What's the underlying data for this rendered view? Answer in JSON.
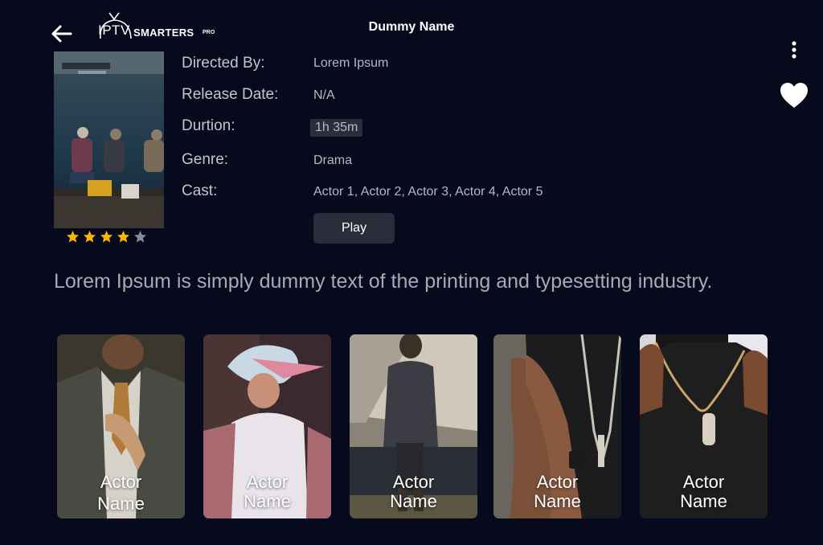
{
  "header": {
    "title": "Dummy Name",
    "logo": {
      "iptv": "IPTV",
      "smarters": "SMARTERS",
      "pro": "PRO"
    },
    "icons": {
      "back": "arrow-left-icon",
      "menu": "more-vertical-icon",
      "favorite": "heart-icon"
    }
  },
  "details": {
    "directed_by_label": "Directed By:",
    "directed_by": "Lorem  Ipsum",
    "release_date_label": "Release Date:",
    "release_date": "N/A",
    "duration_label": "Durtion:",
    "duration": "1h 35m",
    "genre_label": "Genre:",
    "genre": "Drama",
    "cast_label": "Cast:",
    "cast": "Actor 1, Actor 2, Actor 3, Actor 4, Actor 5",
    "play_label": "Play"
  },
  "rating": {
    "value": 4,
    "max": 5,
    "filled_color": "#f5b800",
    "empty_color": "#8a8a96"
  },
  "description": "Lorem Ipsum is simply dummy text of the printing and typesetting industry.",
  "cast_cards": [
    {
      "line1": "Actor",
      "line2": "Name"
    },
    {
      "line1": "Actor",
      "line2": "Name"
    },
    {
      "line1": "Actor",
      "line2": "Name"
    },
    {
      "line1": "Actor",
      "line2": "Name"
    },
    {
      "line1": "Actor",
      "line2": "Name"
    }
  ],
  "colors": {
    "background": "#070a1c",
    "button": "#2a2c3a",
    "text": "#ffffff"
  }
}
